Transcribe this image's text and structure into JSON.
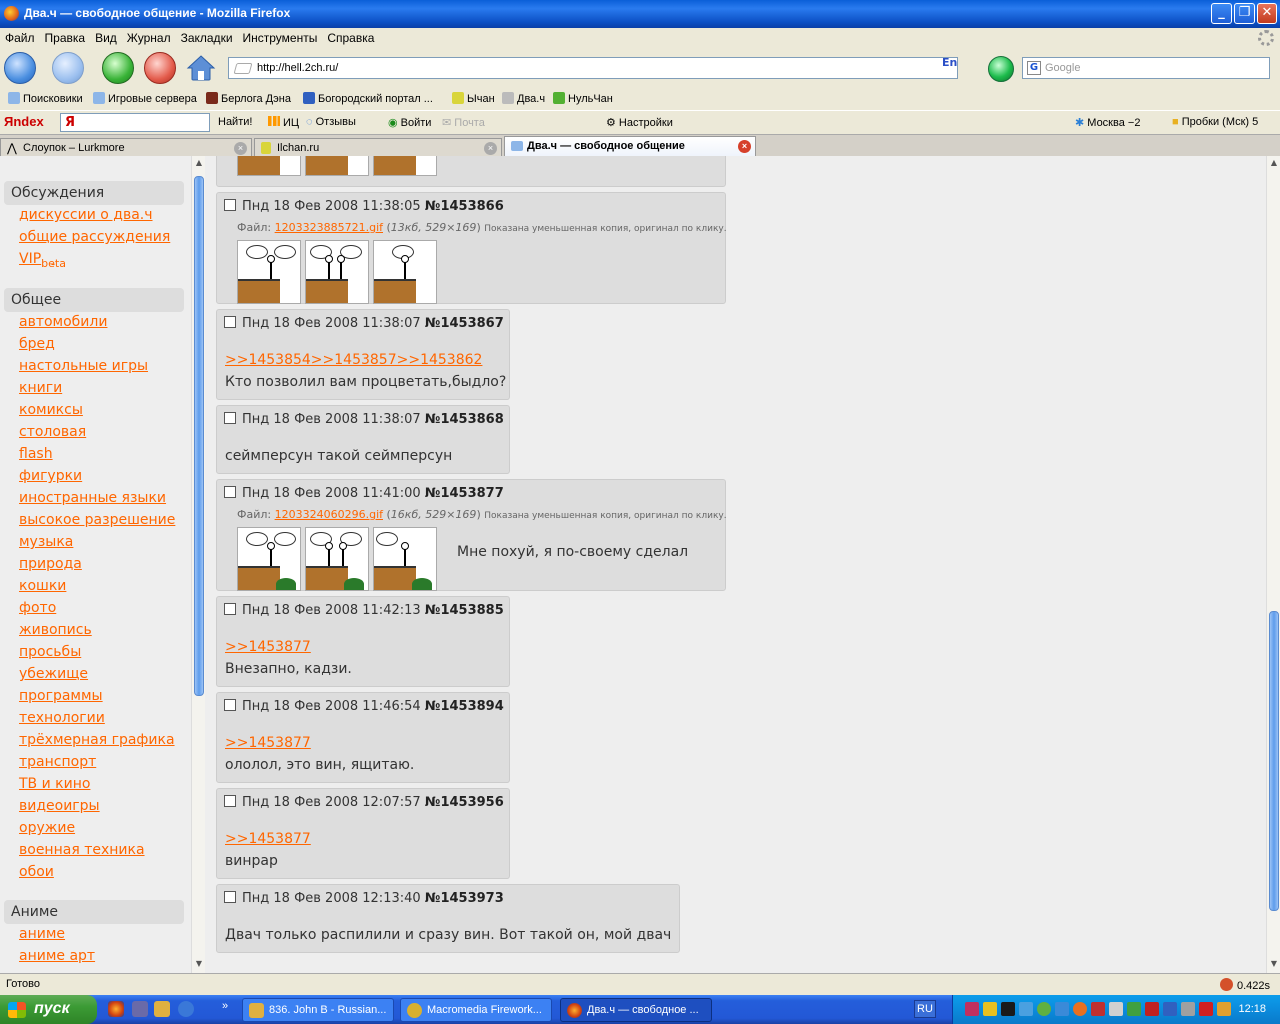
{
  "window": {
    "title": "Два.ч — свободное общение - Mozilla Firefox"
  },
  "menu": [
    "Файл",
    "Правка",
    "Вид",
    "Журнал",
    "Закладки",
    "Инструменты",
    "Справка"
  ],
  "nav": {
    "url": "http://hell.2ch.ru/",
    "lang": "En",
    "search_placeholder": "Google"
  },
  "bookmarks": [
    "Поисковики",
    "Игровые сервера",
    "Берлога Дэна",
    "Богородский портал ...",
    "Ычан",
    "Два.ч",
    "НульЧан"
  ],
  "yandex": {
    "logo": "Яndex",
    "find": "Найти!",
    "ic": "ИЦ",
    "reviews": "Отзывы",
    "login": "Войти",
    "mail": "Почта",
    "settings": "Настройки",
    "weather": "Москва −2",
    "traffic": "Пробки (Мск) 5"
  },
  "tabs": [
    {
      "label": "Слоупок – Lurkmore",
      "active": false
    },
    {
      "label": "Ilchan.ru",
      "active": false
    },
    {
      "label": "Два.ч — свободное общение",
      "active": true
    }
  ],
  "sidebar": {
    "sections": [
      {
        "title": "Обсуждения",
        "links": [
          "дискуссии о два.ч",
          "общие рассуждения",
          "VIP"
        ],
        "vip_sub": "beta"
      },
      {
        "title": "Общее",
        "links": [
          "автомобили",
          "бред",
          "настольные игры",
          "книги",
          "комиксы",
          "столовая",
          "flash",
          "фигурки",
          "иностранные языки",
          "высокое разрешение",
          "музыка",
          "природа",
          "кошки",
          "фото",
          "живопись",
          "просьбы",
          "убежище",
          "программы",
          "технологии",
          "трёхмерная графика",
          "транспорт",
          "ТВ и кино",
          "видеоигры",
          "оружие",
          "военная техника",
          "обои"
        ]
      },
      {
        "title": "Аниме",
        "links": [
          "аниме",
          "аниме арт"
        ]
      }
    ]
  },
  "posts": [
    {
      "date": "Пнд 18 Фев 2008 11:38:05",
      "num": "№1453866",
      "file_label": "Файл:",
      "file": "1203323885721.gif",
      "size": "13кб, 529×169",
      "note": "Показана уменьшенная копия, оригинал по клику."
    },
    {
      "date": "Пнд 18 Фев 2008 11:38:07",
      "num": "№1453867",
      "refs": ">>1453854>>1453857>>1453862",
      "text": "Кто позволил вам процветать,быдло?"
    },
    {
      "date": "Пнд 18 Фев 2008 11:38:07",
      "num": "№1453868",
      "text": "сеймперсун такой сеймперсун"
    },
    {
      "date": "Пнд 18 Фев 2008 11:41:00",
      "num": "№1453877",
      "file_label": "Файл:",
      "file": "1203324060296.gif",
      "size": "16кб, 529×169",
      "note": "Показана уменьшенная копия, оригинал по клику.",
      "text": "Мне похуй, я по-своему сделал"
    },
    {
      "date": "Пнд 18 Фев 2008 11:42:13",
      "num": "№1453885",
      "refs": ">>1453877",
      "text": "Внезапно, кадзи."
    },
    {
      "date": "Пнд 18 Фев 2008 11:46:54",
      "num": "№1453894",
      "refs": ">>1453877",
      "text": "ололол, это вин, ящитаю."
    },
    {
      "date": "Пнд 18 Фев 2008 12:07:57",
      "num": "№1453956",
      "refs": ">>1453877",
      "text": "винрар"
    },
    {
      "date": "Пнд 18 Фев 2008 12:13:40",
      "num": "№1453973",
      "text": "Двач только распилили и сразу вин. Вот такой он, мой двач"
    }
  ],
  "status": {
    "text": "Готово",
    "time": "0.422s"
  },
  "taskbar": {
    "start": "пуск",
    "tasks": [
      "836. John B - Russian...",
      "Macromedia Firework...",
      "Два.ч — свободное ..."
    ],
    "lang": "RU",
    "clock": "12:18"
  }
}
